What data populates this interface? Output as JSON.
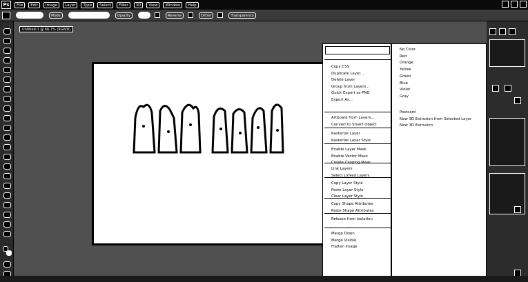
{
  "app": {
    "logo": "Ps",
    "menus": [
      "File",
      "Edit",
      "Image",
      "Layer",
      "Type",
      "Select",
      "Filter",
      "3D",
      "View",
      "Window",
      "Help"
    ]
  },
  "options_bar": {
    "mode_label": "Mode",
    "opacity_label": "Opacity",
    "checks": [
      "Reverse",
      "Dither",
      "Transparency"
    ]
  },
  "document": {
    "tab_title": "Untitled-1 @ 66.7% (RGB/8)"
  },
  "context_menu": {
    "search_placeholder": "",
    "groups": [
      [
        "Copy CSS",
        "Duplicate Layer...",
        "Delete Layer",
        "Group from Layers...",
        "Quick Export as PNG",
        "Export As..."
      ],
      [
        "Artboard from Layers...",
        "Convert to Smart Object"
      ],
      [
        "Rasterize Layer",
        "Rasterize Layer Style"
      ],
      [
        "Enable Layer Mask",
        "Enable Vector Mask",
        "Create Clipping Mask"
      ],
      [
        "Link Layers",
        "Select Linked Layers"
      ],
      [
        "Copy Layer Style",
        "Paste Layer Style",
        "Clear Layer Style"
      ],
      [
        "Copy Shape Attributes",
        "Paste Shape Attributes"
      ],
      [
        "Release from Isolation"
      ],
      [
        "Merge Down",
        "Merge Visible",
        "Flatten Image"
      ]
    ]
  },
  "color_submenu": {
    "colors": [
      "No Color",
      "Red",
      "Orange",
      "Yellow",
      "Green",
      "Blue",
      "Violet",
      "Gray"
    ],
    "extra": [
      "Postcard",
      "New 3D Extrusion from Selected Layer",
      "New 3D Extrusion"
    ]
  }
}
